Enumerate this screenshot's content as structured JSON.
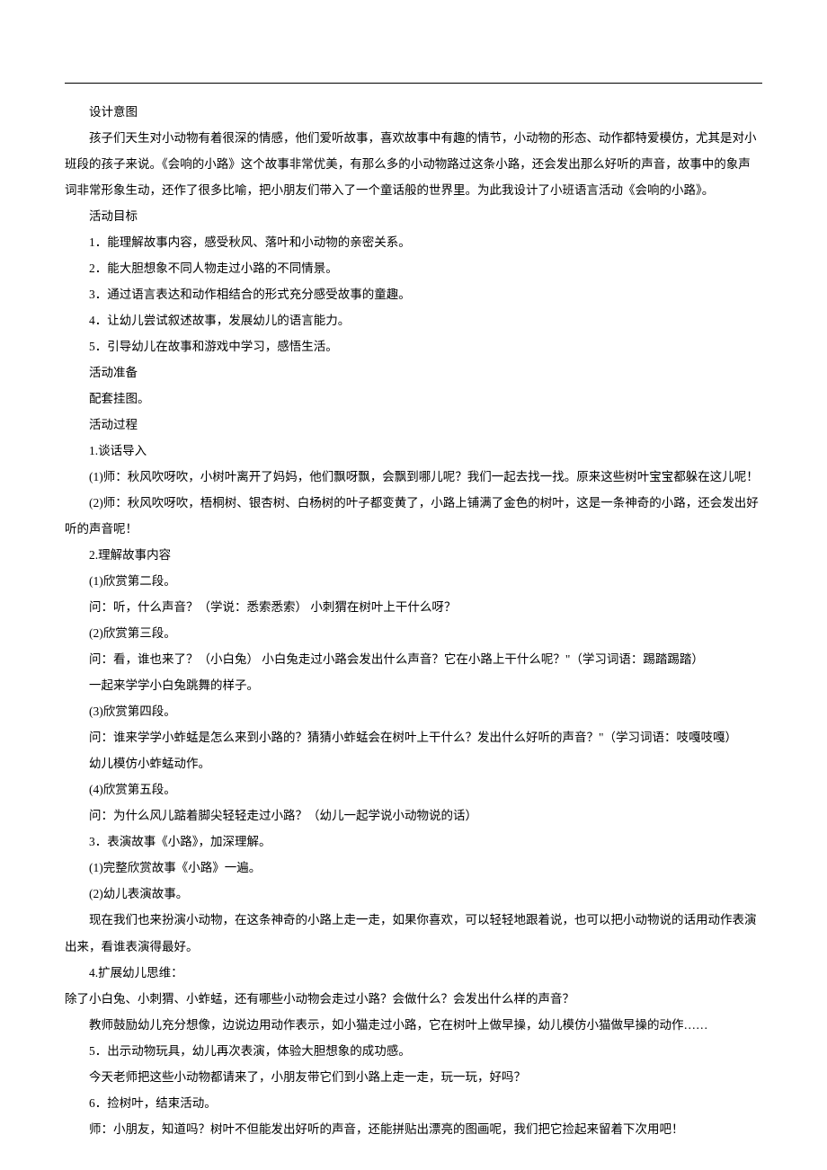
{
  "lines": [
    {
      "text": "设计意图",
      "indent": true
    },
    {
      "text": "孩子们天生对小动物有着很深的情感，他们爱听故事，喜欢故事中有趣的情节，小动物的形态、动作都特爱模仿，尤其是对小班段的孩子来说。《会响的小路》这个故事非常优美，有那么多的小动物路过这条小路，还会发出那么好听的声音，故事中的象声词非常形象生动，还作了很多比喻，把小朋友们带入了一个童话般的世界里。为此我设计了小班语言活动《会响的小路》。",
      "indent": true
    },
    {
      "text": "活动目标",
      "indent": true
    },
    {
      "text": "1．能理解故事内容，感受秋风、落叶和小动物的亲密关系。",
      "indent": true
    },
    {
      "text": "2．能大胆想象不同人物走过小路的不同情景。",
      "indent": true
    },
    {
      "text": "3．通过语言表达和动作相结合的形式充分感受故事的童趣。",
      "indent": true
    },
    {
      "text": "4．让幼儿尝试叙述故事，发展幼儿的语言能力。",
      "indent": true
    },
    {
      "text": "5．引导幼儿在故事和游戏中学习，感悟生活。",
      "indent": true
    },
    {
      "text": "活动准备",
      "indent": true
    },
    {
      "text": "配套挂图。",
      "indent": true
    },
    {
      "text": "活动过程",
      "indent": true
    },
    {
      "text": "1.谈话导入",
      "indent": true
    },
    {
      "text": "(1)师：秋风吹呀吹，小树叶离开了妈妈，他们飘呀飘，会飘到哪儿呢？我们一起去找一找。原来这些树叶宝宝都躲在这儿呢！",
      "indent": true
    },
    {
      "text": "(2)师：秋风吹呀吹，梧桐树、银杏树、白杨树的叶子都变黄了，小路上铺满了金色的树叶，这是一条神奇的小路，还会发出好听的声音呢！",
      "indent": true
    },
    {
      "text": "2.理解故事内容",
      "indent": true
    },
    {
      "text": "(1)欣赏第二段。",
      "indent": true
    },
    {
      "text": "问：听，什么声音？（学说：悉索悉索）  小刺猬在树叶上干什么呀？",
      "indent": true
    },
    {
      "text": "(2)欣赏第三段。",
      "indent": true
    },
    {
      "text": "问：看，谁也来了？（小白兔）  小白兔走过小路会发出什么声音？它在小路上干什么呢？\"（学习词语：踢踏踢踏）",
      "indent": true
    },
    {
      "text": "一起来学学小白兔跳舞的样子。",
      "indent": true
    },
    {
      "text": "(3)欣赏第四段。",
      "indent": true
    },
    {
      "text": "问：谁来学学小蚱蜢是怎么来到小路的？猜猜小蚱蜢会在树叶上干什么？发出什么好听的声音？\"（学习词语：吱嘎吱嘎）",
      "indent": true
    },
    {
      "text": "幼儿模仿小蚱蜢动作。",
      "indent": true
    },
    {
      "text": "(4)欣赏第五段。",
      "indent": true
    },
    {
      "text": "问：为什么风儿踮着脚尖轻轻走过小路？（幼儿一起学说小动物说的话）",
      "indent": true
    },
    {
      "text": "3．表演故事《小路》，加深理解。",
      "indent": true
    },
    {
      "text": "(1)完整欣赏故事《小路》一遍。",
      "indent": true
    },
    {
      "text": "(2)幼儿表演故事。",
      "indent": true
    },
    {
      "text": "现在我们也来扮演小动物，在这条神奇的小路上走一走，如果你喜欢，可以轻轻地跟着说，也可以把小动物说的话用动作表演出来，看谁表演得最好。",
      "indent": true
    },
    {
      "text": "4.扩展幼儿思维：",
      "indent": true
    },
    {
      "text": "除了小白兔、小刺猬、小蚱蜢，还有哪些小动物会走过小路？会做什么？会发出什么样的声音？",
      "indent": false
    },
    {
      "text": "教师鼓励幼儿充分想像，边说边用动作表示，如小猫走过小路，它在树叶上做早操，幼儿模仿小猫做早操的动作……",
      "indent": true
    },
    {
      "text": "5．出示动物玩具，幼儿再次表演，体验大胆想象的成功感。",
      "indent": true
    },
    {
      "text": "今天老师把这些小动物都请来了，小朋友带它们到小路上走一走，玩一玩，好吗？",
      "indent": true
    },
    {
      "text": "6．捡树叶，结束活动。",
      "indent": true
    },
    {
      "text": "师：小朋友，知道吗？树叶不但能发出好听的声音，还能拼贴出漂亮的图画呢，我们把它捡起来留着下次用吧！",
      "indent": true
    }
  ]
}
